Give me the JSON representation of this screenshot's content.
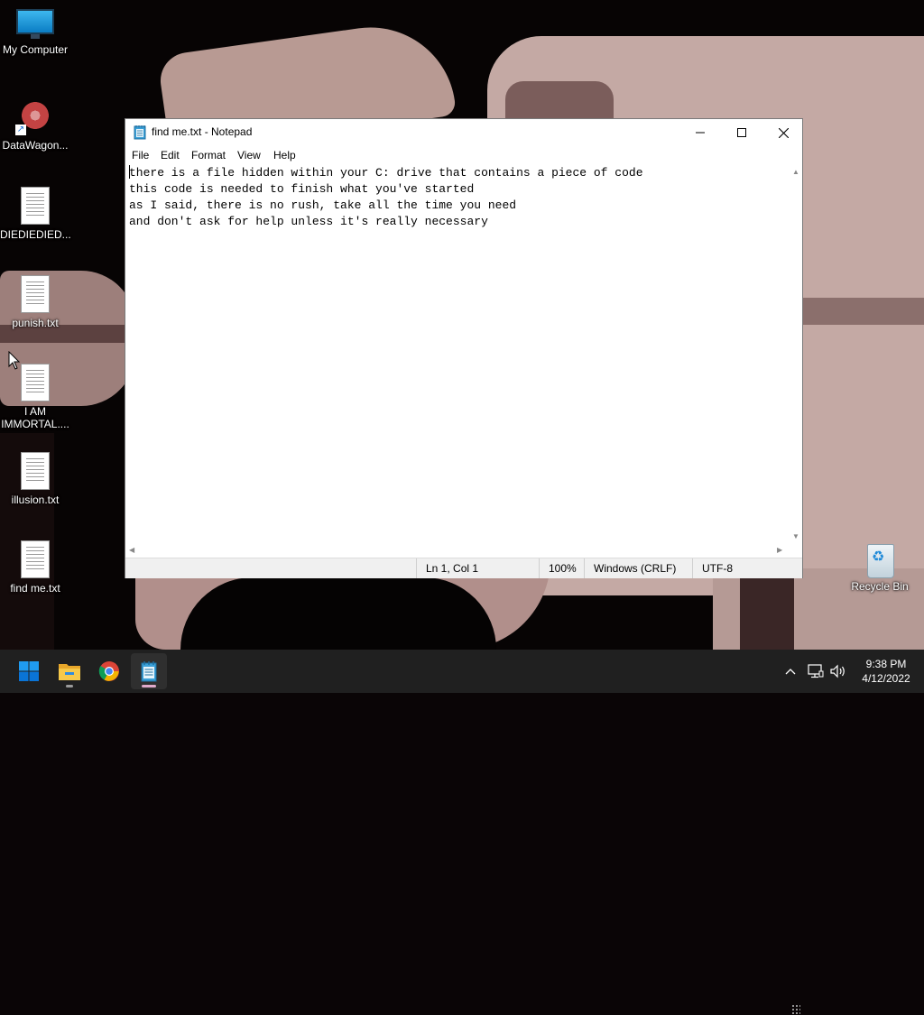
{
  "desktop": {
    "icons": [
      {
        "label": "My Computer",
        "icon": "computer-icon"
      },
      {
        "label": "DataWagon...",
        "icon": "datawagon-shortcut-icon"
      },
      {
        "label": "DIEDIEDIED...",
        "icon": "text-file-icon"
      },
      {
        "label": "punish.txt",
        "icon": "text-file-icon"
      },
      {
        "label": "I AM IMMORTAL....",
        "icon": "text-file-icon"
      },
      {
        "label": "illusion.txt",
        "icon": "text-file-icon"
      },
      {
        "label": "find me.txt",
        "icon": "text-file-icon"
      },
      {
        "label": "Recycle Bin",
        "icon": "recycle-bin-icon"
      }
    ]
  },
  "notepad": {
    "title": "find me.txt - Notepad",
    "menu": [
      "File",
      "Edit",
      "Format",
      "View",
      "Help"
    ],
    "lines": [
      "there is a file hidden within your C: drive that contains a piece of code",
      "this code is needed to finish what you've started",
      "as I said, there is no rush, take all the time you need",
      "and don't ask for help unless it's really necessary"
    ],
    "status": {
      "position": "Ln 1, Col 1",
      "zoom": "100%",
      "line_endings": "Windows (CRLF)",
      "encoding": "UTF-8"
    }
  },
  "taskbar": {
    "apps": [
      "start-icon",
      "file-explorer-icon",
      "chrome-icon",
      "notepad-icon"
    ],
    "active_app": "notepad-icon",
    "clock": {
      "time": "9:38 PM",
      "date": "4/12/2022"
    }
  },
  "colors": {
    "taskbar": "#202020",
    "window_bg": "#ffffff",
    "statusbar": "#f0f0f0",
    "start_blue": "#0078d4"
  }
}
